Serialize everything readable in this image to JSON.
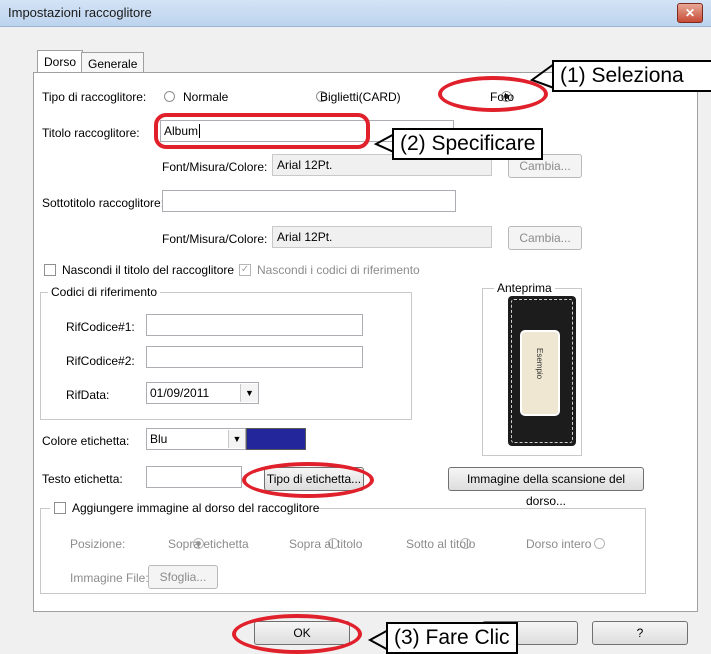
{
  "window": {
    "title": "Impostazioni raccoglitore",
    "close_glyph": "✕"
  },
  "tabs": [
    {
      "label": "Dorso",
      "active": true
    },
    {
      "label": "Generale",
      "active": false
    }
  ],
  "binder_type": {
    "label": "Tipo di raccoglitore:",
    "options": [
      {
        "label": "Normale",
        "selected": false
      },
      {
        "label": "Biglietti(CARD)",
        "selected": false
      },
      {
        "label": "Foto",
        "selected": true
      }
    ]
  },
  "title_field": {
    "label": "Titolo raccoglitore:",
    "value": "Album"
  },
  "font_label": "Font/Misura/Colore:",
  "title_font": "Arial 12Pt.",
  "subtitle_field": {
    "label": "Sottotitolo raccoglitore:",
    "value": ""
  },
  "subtitle_font": "Arial 12Pt.",
  "change_label": "Cambia...",
  "hide_title": {
    "label": "Nascondi il titolo del raccoglitore",
    "checked": false
  },
  "hide_codes": {
    "label": "Nascondi i codici di riferimento",
    "checked": true
  },
  "ref_codes": {
    "group_label": "Codici di riferimento",
    "code1_label": "RifCodice#1:",
    "code2_label": "RifCodice#2:",
    "date_label": "RifData:",
    "date_value": "01/09/2011"
  },
  "preview": {
    "label": "Anteprima",
    "sample_text": "Esempio"
  },
  "label_color": {
    "label": "Colore etichetta:",
    "value": "Blu",
    "swatch": "#23269a"
  },
  "label_text": {
    "label": "Testo etichetta:",
    "value": ""
  },
  "label_type_button": "Tipo di etichetta...",
  "spine_scan_button": "Immagine della scansione del dorso...",
  "add_image": {
    "label": "Aggiungere immagine al dorso del raccoglitore",
    "position_label": "Posizione:",
    "positions": [
      {
        "label": "Sopra etichetta",
        "selected": true
      },
      {
        "label": "Sopra al titolo",
        "selected": false
      },
      {
        "label": "Sotto al titolo",
        "selected": false
      },
      {
        "label": "Dorso intero",
        "selected": false
      }
    ],
    "file_label": "Immagine File:",
    "browse_label": "Sfoglia..."
  },
  "ok_label": "OK",
  "help_label": "?",
  "callouts": {
    "one": "(1) Seleziona",
    "two": "(2) Specificare",
    "three": "(3) Fare Clic"
  },
  "highlight_color": "#e0202a"
}
